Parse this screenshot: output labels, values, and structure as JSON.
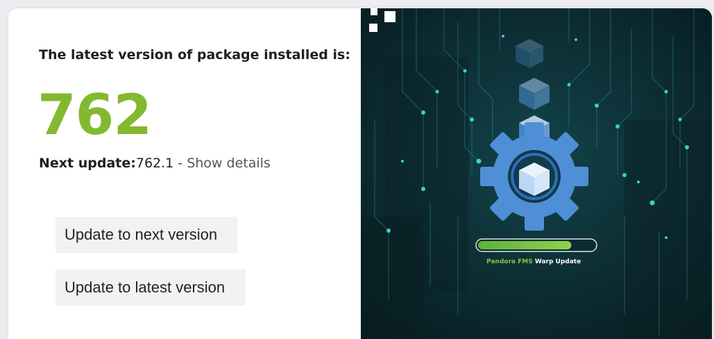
{
  "status": {
    "heading": "The latest version of package installed is:",
    "current_version": "762",
    "next_update_label": "Next update:",
    "next_update_value": "762.1",
    "separator": " - ",
    "details_link": "Show details"
  },
  "actions": {
    "update_next_label": "Update to next version",
    "update_latest_label": "Update to latest version"
  },
  "banner": {
    "brand_name": "Pandora FMS",
    "product_name": " Warp Update",
    "progress": 0.8,
    "colors": {
      "background": "#0c2a30",
      "accent_green": "#82b92e",
      "gear_blue": "#4f8fd8",
      "circuit_teal": "#2fb3b3"
    }
  }
}
